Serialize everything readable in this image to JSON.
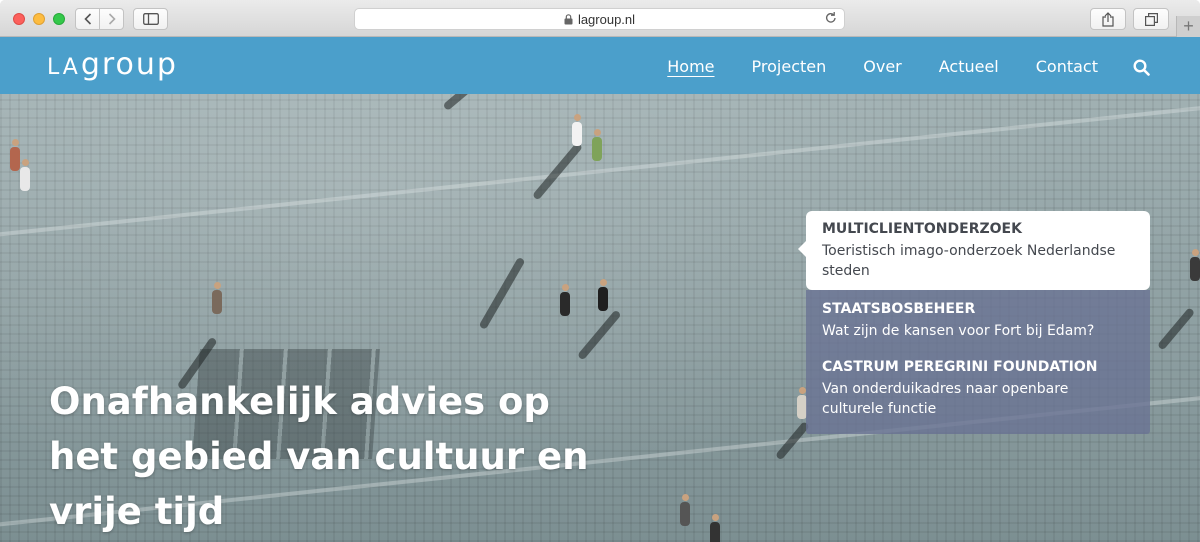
{
  "browser": {
    "url": "lagroup.nl"
  },
  "site": {
    "logo_caps": "LA",
    "logo_rest": "group",
    "nav": [
      {
        "label": "Home",
        "active": true
      },
      {
        "label": "Projecten",
        "active": false
      },
      {
        "label": "Over",
        "active": false
      },
      {
        "label": "Actueel",
        "active": false
      },
      {
        "label": "Contact",
        "active": false
      }
    ],
    "header_color": "#4b9fcb"
  },
  "hero": {
    "headline": "Onafhankelijk advies op het gebied van cultuur en vrije tijd"
  },
  "news": [
    {
      "title": "MULTICLIENTONDERZOEK",
      "description": "Toeristisch imago-onderzoek Nederlandse steden",
      "selected": true
    },
    {
      "title": "STAATSBOSBEHEER",
      "description": "Wat zijn de kansen voor Fort bij Edam?",
      "selected": false
    },
    {
      "title": "CASTRUM PEREGRINI FOUNDATION",
      "description": "Van onderduikadres naar openbare culturele functie",
      "selected": false
    }
  ],
  "icons": {
    "search": "search-icon",
    "lock": "lock-icon",
    "reload": "reload-icon"
  }
}
